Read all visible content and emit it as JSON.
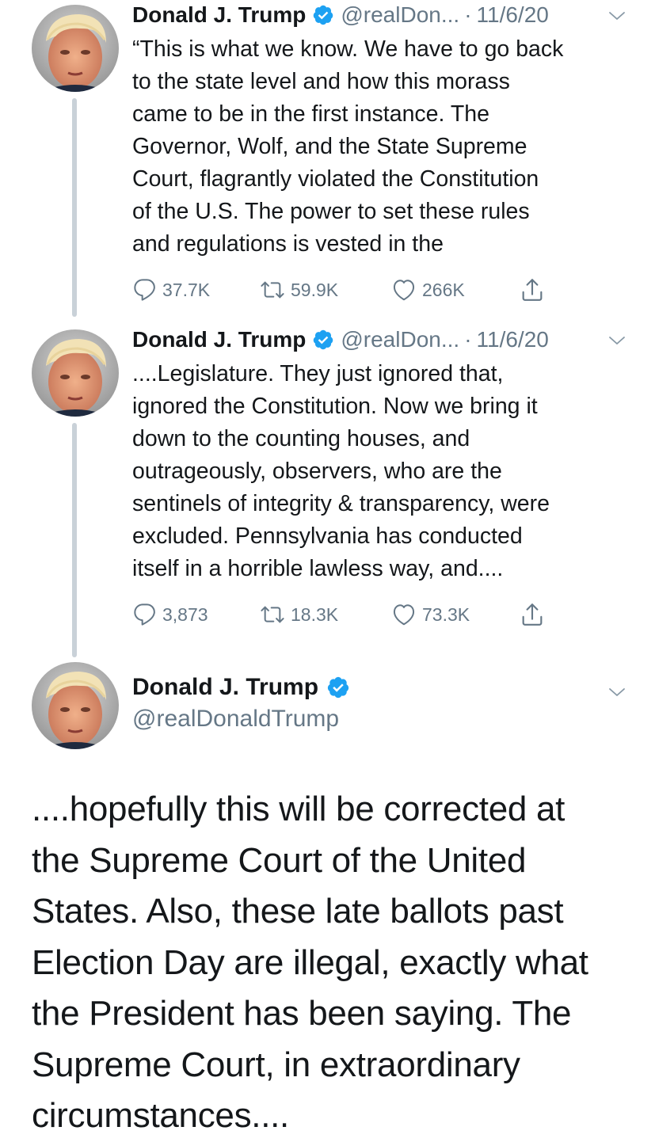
{
  "thread": [
    {
      "author_name": "Donald J. Trump",
      "handle": "@realDon...",
      "separator": "·",
      "date": "11/6/20",
      "text_lines": [
        "“This is what we know. We have to go back",
        "to the state level and how this morass",
        "came to be in the first instance. The",
        "Governor, Wolf, and the State Supreme",
        "Court, flagrantly violated the Constitution",
        "of the U.S. The power to set these rules",
        "and regulations is vested in the"
      ],
      "replies": "37.7K",
      "retweets": "59.9K",
      "likes": "266K"
    },
    {
      "author_name": "Donald J. Trump",
      "handle": "@realDon...",
      "separator": "·",
      "date": "11/6/20",
      "text_lines": [
        "....Legislature. They just ignored that,",
        "ignored the Constitution. Now we bring it",
        "down to the counting houses, and",
        "outrageously, observers, who are the",
        "sentinels of integrity & transparency, were",
        "excluded. Pennsylvania has conducted",
        "itself in a horrible lawless way, and...."
      ],
      "replies": "3,873",
      "retweets": "18.3K",
      "likes": "73.3K"
    }
  ],
  "main_tweet": {
    "author_name": "Donald J. Trump",
    "handle": "@realDonaldTrump",
    "text_lines": [
      "....hopefully this will be corrected at",
      "the Supreme Court of the United",
      "States. Also, these late ballots past",
      "Election Day are illegal, exactly what",
      "the President has been saying. The",
      "Supreme Court, in extraordinary",
      "circumstances...."
    ]
  },
  "colors": {
    "text": "#14171a",
    "secondary": "#657786",
    "verified": "#1da1f2",
    "thread_line": "#c9d1d8"
  },
  "icons": {
    "reply": "speech-bubble",
    "retweet": "retweet-arrows",
    "like": "heart-outline",
    "share": "share-arrow-up",
    "verified": "verified-badge",
    "menu": "chevron-down"
  }
}
